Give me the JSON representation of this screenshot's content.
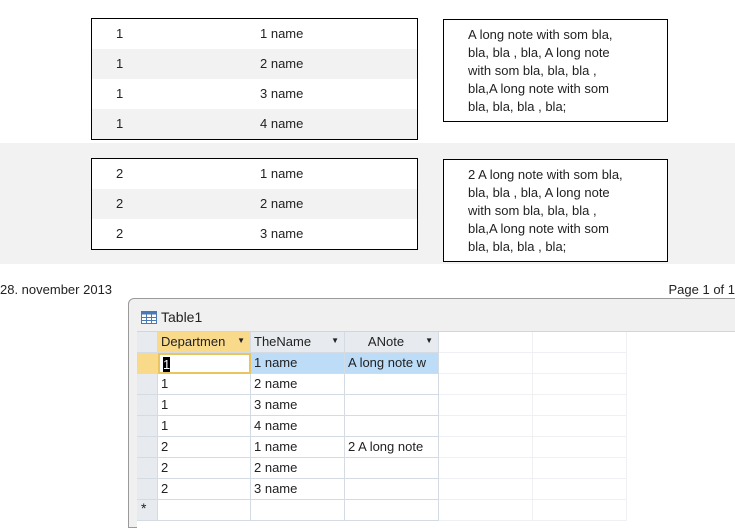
{
  "report": {
    "groups": [
      {
        "rows": [
          {
            "dept": "1",
            "name": "1 name"
          },
          {
            "dept": "1",
            "name": "2 name"
          },
          {
            "dept": "1",
            "name": "3 name"
          },
          {
            "dept": "1",
            "name": "4 name"
          }
        ],
        "note_lines": [
          "A long note with som bla,",
          "bla, bla , bla, A long note",
          "with som bla, bla, bla ,",
          "bla,A long note with som",
          "bla, bla, bla , bla;"
        ]
      },
      {
        "rows": [
          {
            "dept": "2",
            "name": "1 name"
          },
          {
            "dept": "2",
            "name": "2 name"
          },
          {
            "dept": "2",
            "name": "3 name"
          }
        ],
        "note_lines": [
          "2 A long note with som bla,",
          "bla, bla , bla, A long note",
          "with som bla, bla, bla ,",
          "bla,A long note with som",
          "bla, bla, bla , bla;"
        ]
      }
    ],
    "date": "28. november 2013",
    "page": "Page 1 of 1"
  },
  "datasheet": {
    "title": "Table1",
    "icon": "table-icon",
    "columns": [
      "Departmen",
      "TheName",
      "ANote"
    ],
    "rows": [
      [
        "1",
        "1 name",
        "A long note w"
      ],
      [
        "1",
        "2 name",
        ""
      ],
      [
        "1",
        "3 name",
        ""
      ],
      [
        "1",
        "4 name",
        ""
      ],
      [
        "2",
        "1 name",
        "2 A long note"
      ],
      [
        "2",
        "2 name",
        ""
      ],
      [
        "2",
        "3 name",
        ""
      ]
    ],
    "new_row_marker": "*",
    "colors": {
      "selected_header": "#f9d98a",
      "selected_row": "#bcdcf7",
      "active_cell_border": "#e8c560"
    }
  }
}
